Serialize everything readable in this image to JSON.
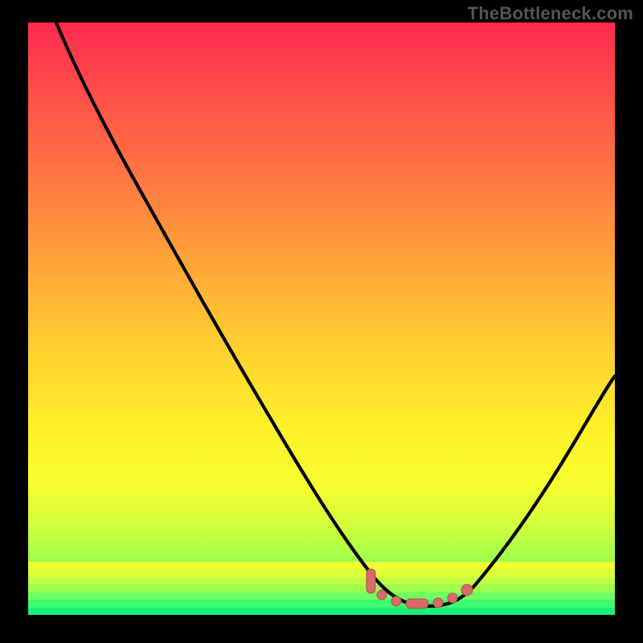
{
  "watermark": "TheBottleneck.com",
  "colors": {
    "background": "#000000",
    "watermark": "#555555",
    "curve": "#000000",
    "marker_fill": "#d86a6a",
    "marker_stroke": "#b34e4e",
    "gradient_top": "#ff2a4f",
    "gradient_bottom": "#16e97a"
  },
  "chart_data": {
    "type": "line",
    "title": "",
    "xlabel": "",
    "ylabel": "",
    "xlim": [
      0,
      100
    ],
    "ylim": [
      0,
      100
    ],
    "grid": false,
    "legend": false,
    "series": [
      {
        "name": "bottleneck-curve",
        "x": [
          0,
          5,
          10,
          15,
          20,
          25,
          30,
          35,
          40,
          45,
          50,
          55,
          60,
          63,
          66,
          70,
          74,
          80,
          85,
          90,
          95,
          100
        ],
        "values": [
          100,
          95,
          89,
          82,
          75,
          67,
          59,
          51,
          42,
          34,
          25,
          17,
          10,
          6,
          4,
          3,
          4,
          8,
          15,
          25,
          38,
          55
        ]
      }
    ],
    "markers": {
      "name": "highlight-segment",
      "x": [
        58,
        60,
        62,
        65,
        68,
        71,
        73
      ],
      "values": [
        11,
        9,
        7,
        5,
        4,
        4,
        5
      ]
    },
    "annotations": []
  }
}
